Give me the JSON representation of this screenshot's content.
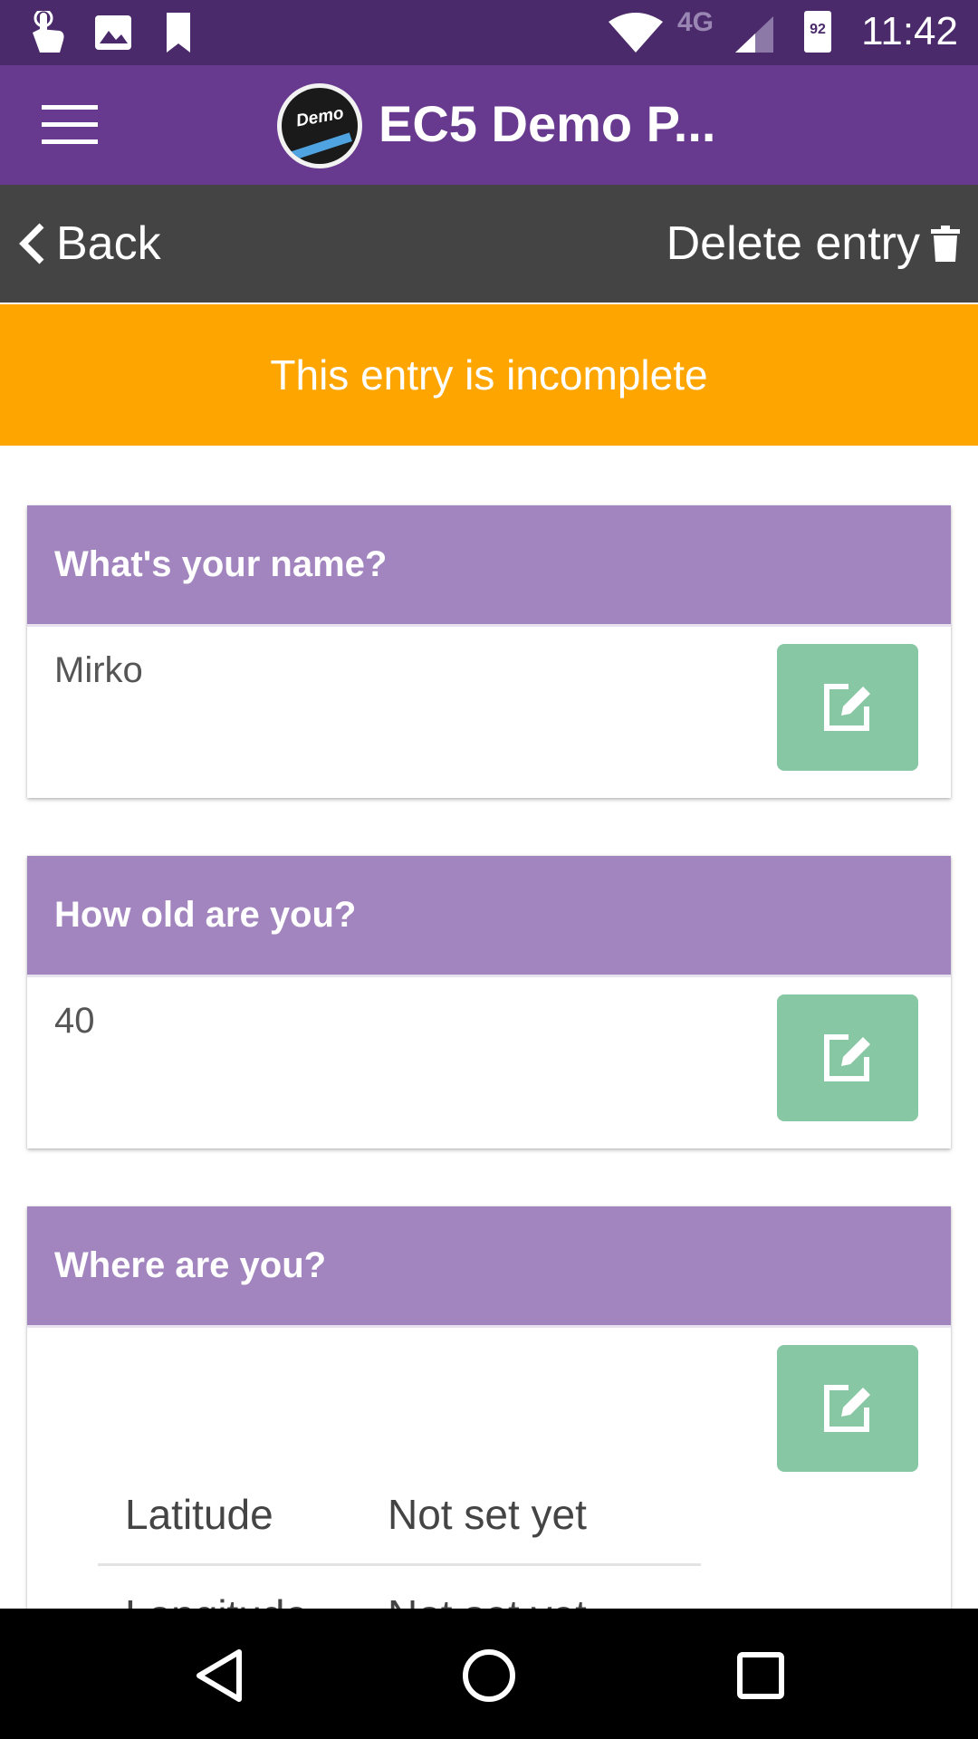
{
  "status_bar": {
    "time": "11:42",
    "network": "4G",
    "battery_level": "92",
    "icons": [
      "touch-app-icon",
      "image-icon",
      "bookmark-icon",
      "wifi-icon",
      "signal-icon",
      "battery-icon"
    ]
  },
  "app_bar": {
    "logo_text": "Demo",
    "title": "EC5 Demo P..."
  },
  "toolbar": {
    "back_label": "Back",
    "delete_label": "Delete entry"
  },
  "banner": {
    "text": "This entry is incomplete",
    "color": "#ffa500"
  },
  "questions": [
    {
      "question": "What's your name?",
      "answer": "Mirko"
    },
    {
      "question": "How old are you?",
      "answer": "40"
    },
    {
      "question": "Where are you?",
      "location": [
        {
          "label": "Latitude",
          "value": "Not set yet"
        },
        {
          "label": "Longitude",
          "value": "Not set yet"
        }
      ]
    }
  ],
  "colors": {
    "status_bar": "#4a2a6b",
    "app_bar": "#673a8f",
    "toolbar": "#444444",
    "question_header": "#a285bf",
    "edit_button": "#88c7a4"
  },
  "nav_bar": {
    "icons": [
      "back-triangle-icon",
      "home-circle-icon",
      "recents-square-icon"
    ]
  }
}
